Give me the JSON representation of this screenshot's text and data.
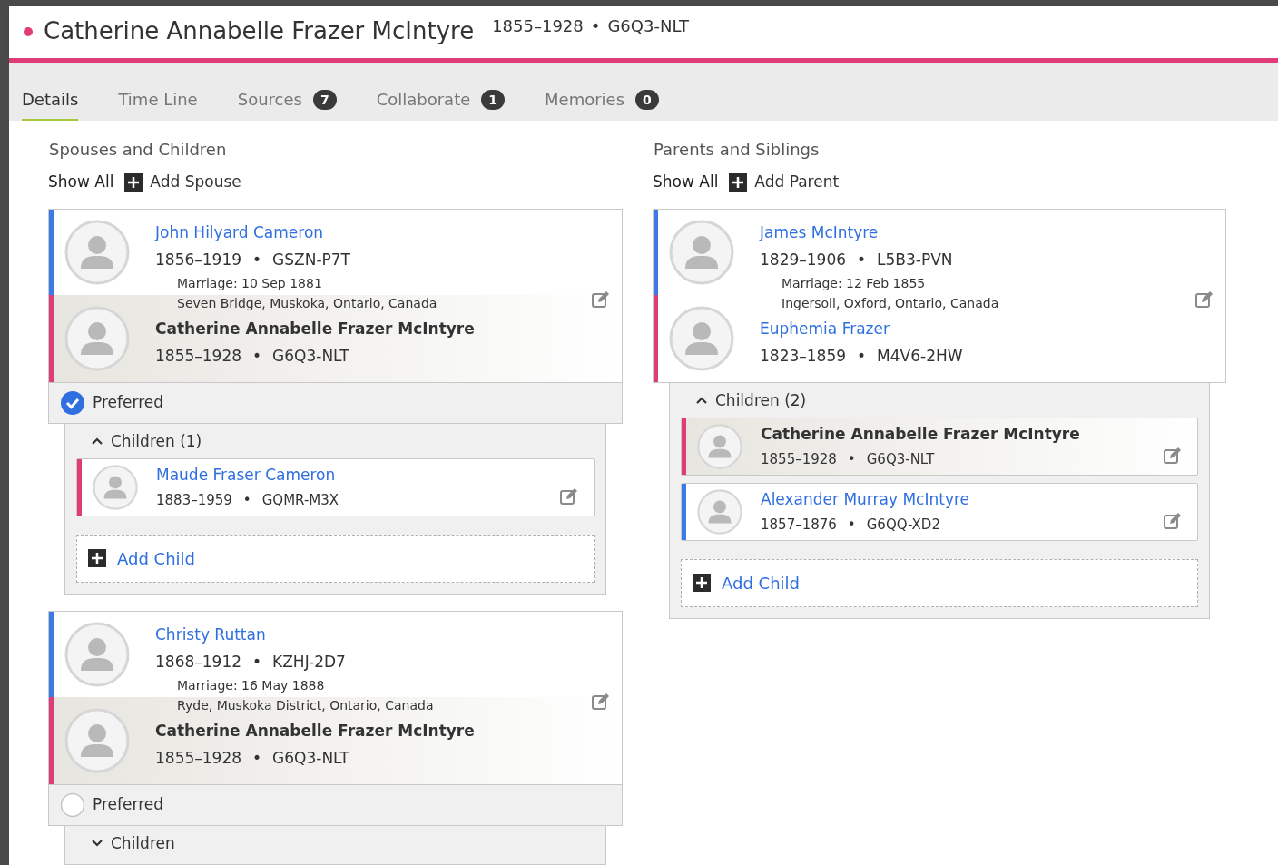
{
  "header": {
    "name": "Catherine Annabelle Frazer McIntyre",
    "dates": "1855–1928",
    "separator": "•",
    "pid": "G6Q3-NLT"
  },
  "tabs": [
    {
      "label": "Details",
      "selected": true
    },
    {
      "label": "Time Line",
      "selected": false
    },
    {
      "label": "Sources",
      "count": "7",
      "selected": false
    },
    {
      "label": "Collaborate",
      "count": "1",
      "selected": false
    },
    {
      "label": "Memories",
      "count": "0",
      "selected": false
    }
  ],
  "spouses": {
    "title": "Spouses and Children",
    "show_all": "Show All",
    "add_label": "Add Spouse",
    "families": [
      {
        "persons": [
          {
            "name": "John Hilyard Cameron",
            "dates": "1856–1919",
            "pid": "GSZN-P7T",
            "color": "#3b7be8",
            "current": false
          },
          {
            "name": "Catherine Annabelle Frazer McIntyre",
            "dates": "1855–1928",
            "pid": "G6Q3-NLT",
            "color": "#e03c78",
            "current": true
          }
        ],
        "marriage": {
          "date": "Marriage: 10 Sep 1881",
          "place": "Seven Bridge, Muskoka, Ontario, Canada"
        },
        "preferred": {
          "label": "Preferred",
          "selected": true
        },
        "children": {
          "label": "Children (1)",
          "expanded": true,
          "items": [
            {
              "name": "Maude Fraser Cameron",
              "dates": "1883–1959",
              "pid": "GQMR-M3X",
              "color": "#e03c78",
              "current": false
            }
          ],
          "add_label": "Add Child"
        }
      },
      {
        "persons": [
          {
            "name": "Christy Ruttan",
            "dates": "1868–1912",
            "pid": "KZHJ-2D7",
            "color": "#3b7be8",
            "current": false
          },
          {
            "name": "Catherine Annabelle Frazer McIntyre",
            "dates": "1855–1928",
            "pid": "G6Q3-NLT",
            "color": "#e03c78",
            "current": true
          }
        ],
        "marriage": {
          "date": "Marriage: 16 May 1888",
          "place": "Ryde, Muskoka District, Ontario, Canada"
        },
        "preferred": {
          "label": "Preferred",
          "selected": false
        },
        "children": {
          "label": "Children",
          "expanded": false
        }
      }
    ]
  },
  "parents": {
    "title": "Parents and Siblings",
    "show_all": "Show All",
    "add_label": "Add Parent",
    "families": [
      {
        "persons": [
          {
            "name": "James McIntyre",
            "dates": "1829–1906",
            "pid": "L5B3-PVN",
            "color": "#3b7be8",
            "current": false
          },
          {
            "name": "Euphemia Frazer",
            "dates": "1823–1859",
            "pid": "M4V6-2HW",
            "color": "#e03c78",
            "current": false
          }
        ],
        "marriage": {
          "date": "Marriage: 12 Feb 1855",
          "place": "Ingersoll, Oxford, Ontario, Canada"
        },
        "children": {
          "label": "Children (2)",
          "expanded": true,
          "items": [
            {
              "name": "Catherine Annabelle Frazer McIntyre",
              "dates": "1855–1928",
              "pid": "G6Q3-NLT",
              "color": "#e03c78",
              "current": true
            },
            {
              "name": "Alexander Murray McIntyre",
              "dates": "1857–1876",
              "pid": "G6QQ-XD2",
              "color": "#3b7be8",
              "current": false
            }
          ],
          "add_label": "Add Child"
        }
      }
    ]
  }
}
